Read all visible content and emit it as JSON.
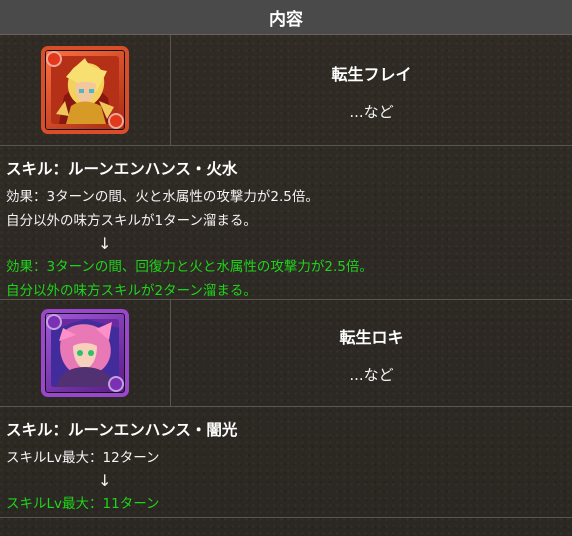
{
  "header": {
    "title": "内容"
  },
  "entries": [
    {
      "name": "転生フレイ",
      "etc": "...など",
      "icon": "frey-card-icon",
      "accent": "#d84e2a",
      "skill_title": "スキル：ルーンエンハンス・火水",
      "before": [
        "効果：3ターンの間、火と水属性の攻撃力が2.5倍。",
        "自分以外の味方スキルが1ターン溜まる。"
      ],
      "arrow": "↓",
      "after": [
        "効果：3ターンの間、回復力と火と水属性の攻撃力が2.5倍。",
        "自分以外の味方スキルが2ターン溜まる。"
      ]
    },
    {
      "name": "転生ロキ",
      "etc": "...など",
      "icon": "loki-card-icon",
      "accent": "#9a46cd",
      "skill_title": "スキル：ルーンエンハンス・闇光",
      "before": [
        "スキルLv最大：12ターン"
      ],
      "arrow": "↓",
      "after": [
        "スキルLv最大：11ターン"
      ]
    }
  ],
  "colors": {
    "header_background": "#4a4a4a",
    "updated_text": "#1fd51b"
  }
}
